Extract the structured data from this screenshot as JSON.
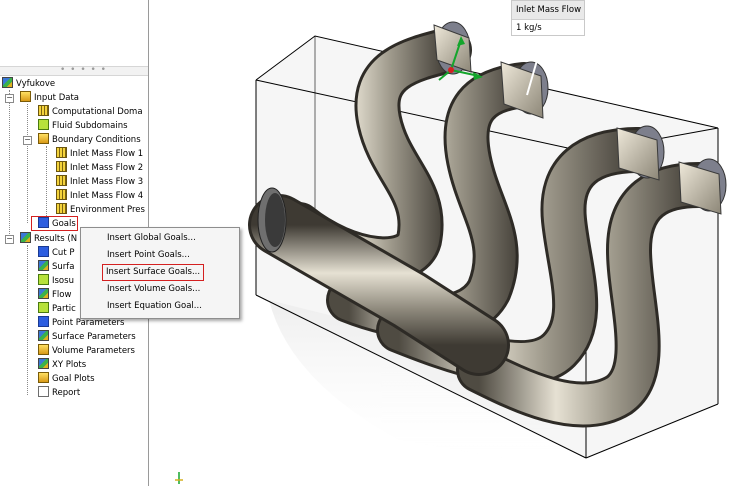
{
  "tree": {
    "root": "Vyfukove",
    "items": [
      {
        "label": "Input Data"
      },
      {
        "label": "Computational Doma"
      },
      {
        "label": "Fluid Subdomains"
      },
      {
        "label": "Boundary Conditions"
      },
      {
        "label": "Inlet Mass Flow 1"
      },
      {
        "label": "Inlet Mass Flow 2"
      },
      {
        "label": "Inlet Mass Flow 3"
      },
      {
        "label": "Inlet Mass Flow 4"
      },
      {
        "label": "Environment Pres"
      },
      {
        "label": "Goals"
      },
      {
        "label": "Results (N"
      },
      {
        "label": "Cut P"
      },
      {
        "label": "Surfa"
      },
      {
        "label": "Isosu"
      },
      {
        "label": "Flow"
      },
      {
        "label": "Partic"
      },
      {
        "label": "Point Parameters"
      },
      {
        "label": "Surface Parameters"
      },
      {
        "label": "Volume Parameters"
      },
      {
        "label": "XY Plots"
      },
      {
        "label": "Goal Plots"
      },
      {
        "label": "Report"
      }
    ]
  },
  "context_menu": {
    "items": [
      "Insert Global Goals...",
      "Insert Point Goals...",
      "Insert Surface Goals...",
      "Insert Volume Goals...",
      "Insert Equation Goal..."
    ],
    "highlighted": "Insert Surface Goals..."
  },
  "tooltip": {
    "title": "Inlet Mass Flow",
    "value": "1 kg/s"
  },
  "colors": {
    "highlight_border": "#d42020",
    "metal_light": "#e6e1d3",
    "metal_dark": "#4f4b42"
  }
}
